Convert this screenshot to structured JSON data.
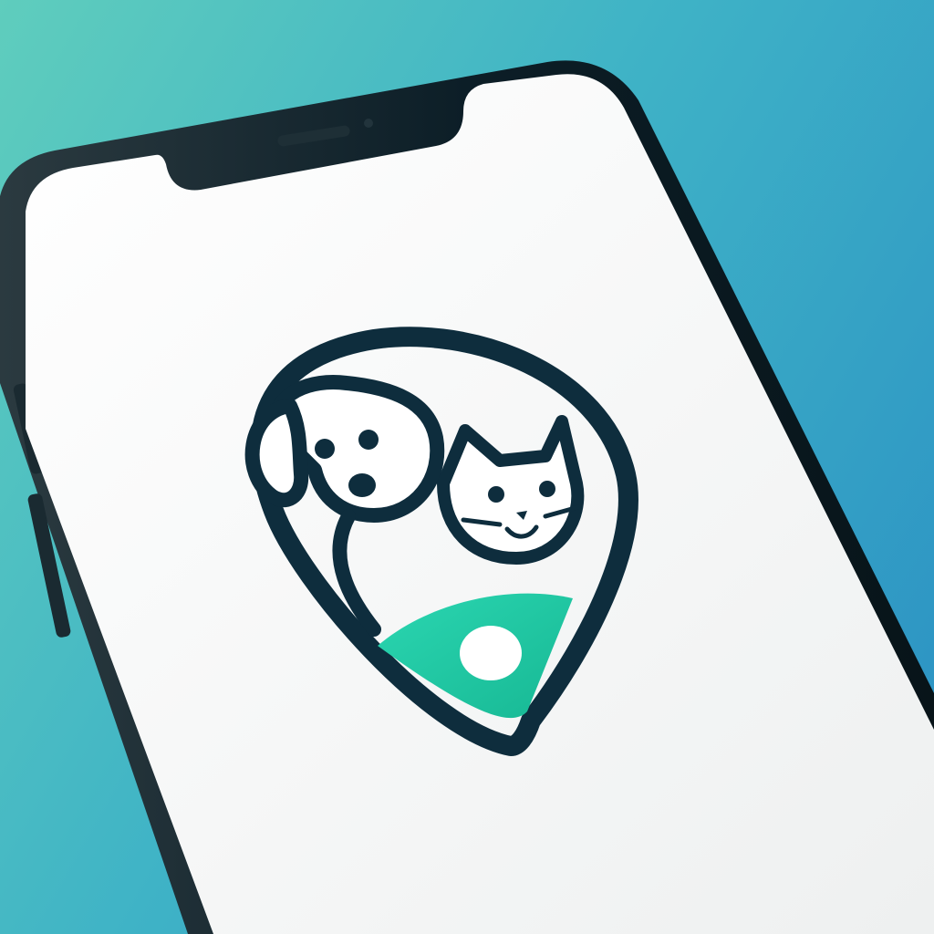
{
  "scene": {
    "background_start": "#5fcdbd",
    "background_end": "#2a8fc4"
  },
  "phone": {
    "frame_color": "#0c1e27",
    "screen_color": "#f7f8f8"
  },
  "app_icon": {
    "name": "pet-location-pin-logo",
    "outline_color": "#0e2d3d",
    "accent_color": "#22c9a2",
    "depicts": [
      "dog-icon",
      "cat-icon",
      "map-pin-icon"
    ]
  }
}
